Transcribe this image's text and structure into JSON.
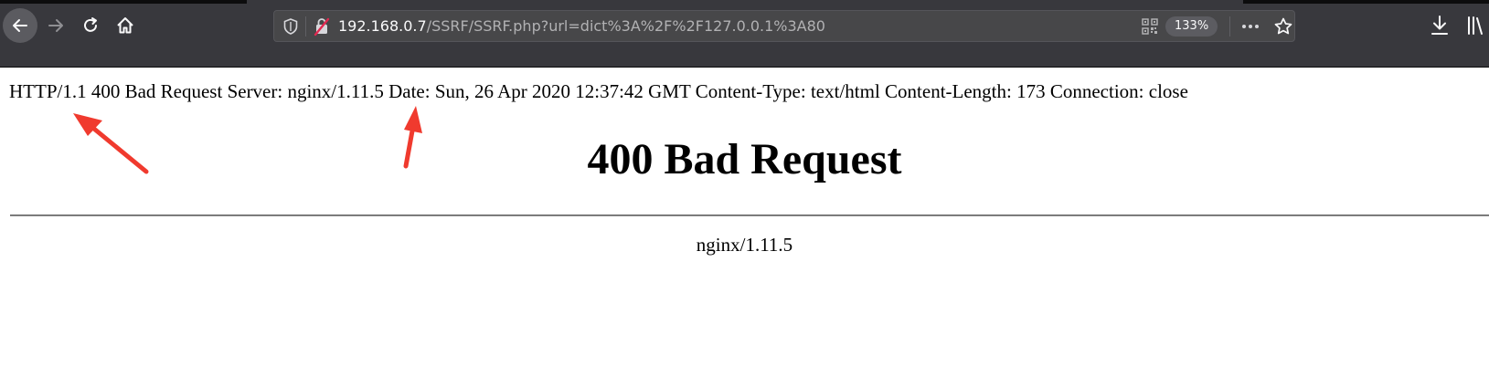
{
  "browser": {
    "url_host": "192.168.0.7",
    "url_path": "/SSRF/SSRF.php?url=dict%3A%2F%2F127.0.0.1%3A80",
    "zoom": "133%",
    "icons": {
      "back": "arrow-left-icon",
      "forward": "arrow-right-icon",
      "reload": "reload-icon",
      "home": "home-icon",
      "shield": "tracking-shield-icon",
      "lock": "insecure-lock-icon",
      "qr": "qr-code-icon",
      "more": "more-dots-icon",
      "bookmark": "star-icon",
      "download": "download-icon",
      "library": "library-icon"
    }
  },
  "page": {
    "response_line": "HTTP/1.1 400 Bad Request Server: nginx/1.11.5 Date: Sun, 26 Apr 2020 12:37:42 GMT Content-Type: text/html Content-Length: 173 Connection: close",
    "title": "400 Bad Request",
    "footer": "nginx/1.11.5"
  },
  "colors": {
    "toolbar": "#38383d",
    "urlbar": "#474749",
    "annotation_arrow": "#f03a2e"
  }
}
